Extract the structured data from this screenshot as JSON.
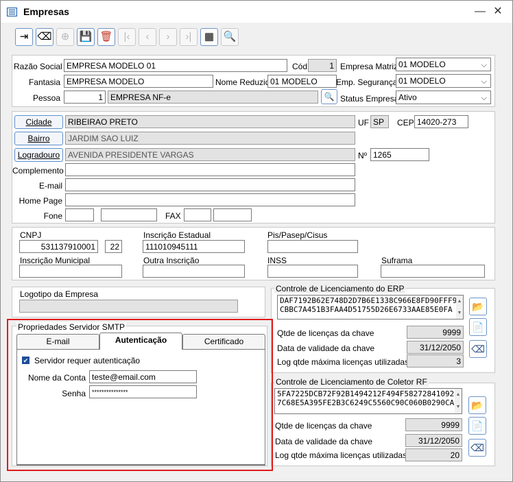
{
  "window": {
    "title": "Empresas",
    "minimize": "—",
    "close": "✕"
  },
  "toolbar": {
    "exit": "⇥",
    "clear": "⌫",
    "add": "⊕",
    "save": "💾",
    "delete": "🗑",
    "first": "|‹",
    "prev": "‹",
    "next": "›",
    "last": "›|",
    "grid": "▦",
    "search": "🔍"
  },
  "company": {
    "razao_label": "Razão Social",
    "razao": "EMPRESA MODELO 01",
    "cod_label": "Cód",
    "cod": "1",
    "matriz_label": "Empresa Matriz",
    "matriz": "01 MODELO",
    "fantasia_label": "Fantasia",
    "fantasia": "EMPRESA MODELO",
    "nome_reduzido_label": "Nome Reduzido",
    "nome_reduzido": "01 MODELO",
    "seguranca_label": "Emp. Segurança",
    "seguranca": "01 MODELO",
    "pessoa_label": "Pessoa",
    "pessoa_code": "1",
    "pessoa_name": "EMPRESA NF-e",
    "status_label": "Status Empresa",
    "status": "Ativo"
  },
  "address": {
    "cidade_label": "Cidade",
    "cidade": "RIBEIRAO PRETO",
    "uf_label": "UF",
    "uf": "SP",
    "cep_label": "CEP",
    "cep": "14020-273",
    "bairro_label": "Bairro",
    "bairro": "JARDIM SAO LUIZ",
    "logradouro_label": "Logradouro",
    "logradouro": "AVENIDA PRESIDENTE VARGAS",
    "numero_label": "Nº",
    "numero": "1265",
    "complemento_label": "Complemento",
    "complemento": "",
    "email_label": "E-mail",
    "email": "",
    "homepage_label": "Home Page",
    "homepage": "",
    "fone_label": "Fone",
    "fone_ddd": "",
    "fone": "",
    "fax_label": "FAX",
    "fax_ddd": "",
    "fax": ""
  },
  "docs": {
    "cnpj_label": "CNPJ",
    "cnpj": "531137910001",
    "cnpj_dv": "22",
    "ie_label": "Inscrição Estadual",
    "ie": "111010945111",
    "pis_label": "Pis/Pasep/Cisus",
    "pis": "",
    "im_label": "Inscrição Municipal",
    "im": "",
    "outra_label": "Outra Inscrição",
    "outra": "",
    "inss_label": "INSS",
    "inss": "",
    "suframa_label": "Suframa",
    "suframa": ""
  },
  "logo": {
    "label": "Logotipo da Empresa",
    "path": ""
  },
  "erp_license": {
    "title": "Controle de Licenciamento do ERP",
    "key_line1": "DAF7192B62E748D2D7B6E1338C966E8FD90FFF9",
    "key_line2": "CBBC7A451B3FAA4D51755D26E6733AAE85E0FA",
    "qtd_label": "Qtde de licenças da chave",
    "qtd": "9999",
    "validade_label": "Data de validade da chave",
    "validade": "31/12/2050",
    "max_label": "Log qtde máxima licenças utilizadas",
    "max": "3"
  },
  "rf_license": {
    "title": "Controle de Licenciamento de Coletor RF",
    "key_line1": "5FA7225DCB72F92B1494212F494F58272841092F",
    "key_line2": "7C68E5A395FE2B3C6249C5560C90C060B0290CA",
    "qtd_label": "Qtde de licenças da chave",
    "qtd": "9999",
    "validade_label": "Data de validade da chave",
    "validade": "31/12/2050",
    "max_label": "Log qtde máxima licenças utilizadas",
    "max": "20"
  },
  "smtp": {
    "title": "Propriedades Servidor SMTP",
    "tabs": [
      "E-mail",
      "Autenticação",
      "Certificado"
    ],
    "auth_label": "Servidor requer autenticação",
    "conta_label": "Nome da Conta",
    "conta": "teste@email.com",
    "senha_label": "Senha",
    "senha": "***************"
  }
}
